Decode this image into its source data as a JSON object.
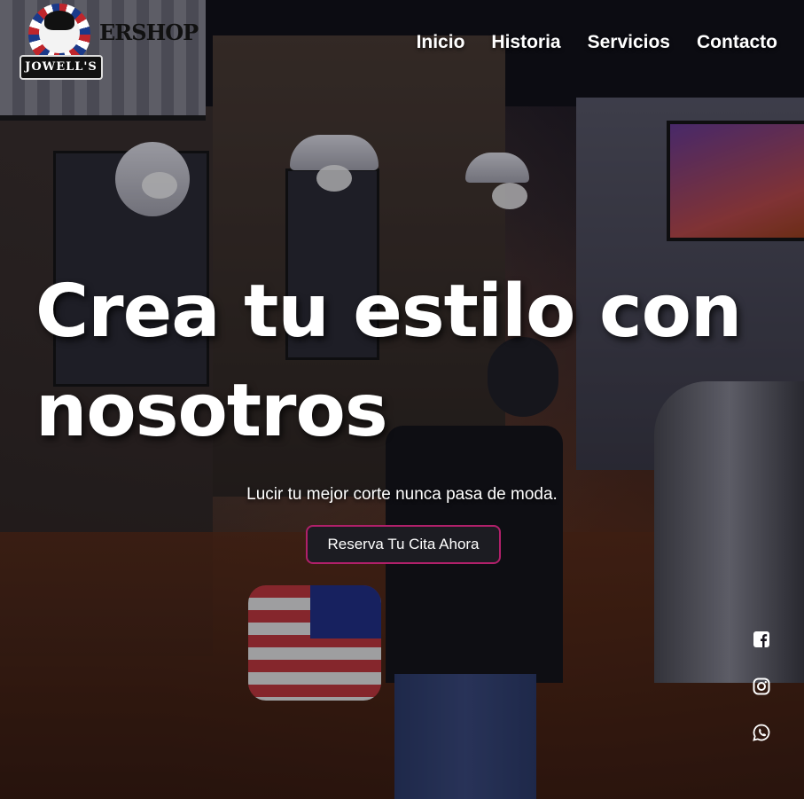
{
  "brand": {
    "logo_text": "JOWELL'S",
    "sign_text": "ERSHOP"
  },
  "nav": {
    "items": [
      {
        "label": "Inicio"
      },
      {
        "label": "Historia"
      },
      {
        "label": "Servicios"
      },
      {
        "label": "Contacto"
      }
    ]
  },
  "hero": {
    "headline": "Crea tu estilo con nosotros",
    "subtitle": "Lucir tu mejor corte nunca pasa de moda.",
    "cta_label": "Reserva Tu Cita Ahora"
  },
  "social": {
    "icons": [
      "facebook-icon",
      "instagram-icon",
      "whatsapp-icon"
    ]
  },
  "colors": {
    "cta_border": "#b0206a",
    "cta_bg": "#1c1c22",
    "text": "#ffffff"
  }
}
